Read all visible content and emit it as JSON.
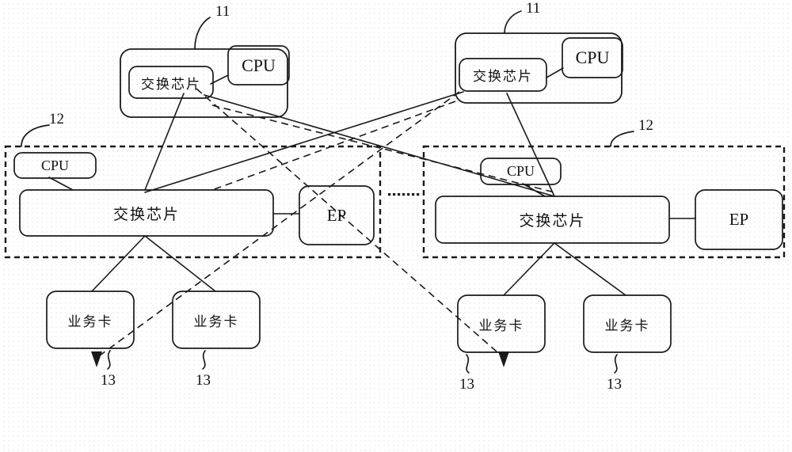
{
  "figure": {
    "kind": "patent-block-diagram",
    "stroke_color": "#1a1a1a",
    "background_color": "#ffffff",
    "dot_grid_color": "#c9c9c9"
  },
  "labels": {
    "switch_chip": "交换芯片",
    "cpu": "CPU",
    "ep": "EP",
    "service_card": "业务卡",
    "ref_11": "11",
    "ref_12": "12",
    "ref_13": "13",
    "ellipsis": "▫▫▫▫▫▫▫▫"
  },
  "modules": {
    "top": [
      {
        "id": "top-module-left",
        "ref": "11",
        "children": [
          {
            "id": "switch-chip",
            "label": "交换芯片"
          },
          {
            "id": "cpu",
            "label": "CPU"
          }
        ]
      },
      {
        "id": "top-module-right",
        "ref": "11",
        "children": [
          {
            "id": "switch-chip",
            "label": "交换芯片"
          },
          {
            "id": "cpu",
            "label": "CPU"
          }
        ]
      }
    ],
    "middle": [
      {
        "id": "line-card-left",
        "ref": "12",
        "children": [
          {
            "id": "cpu",
            "label": "CPU"
          },
          {
            "id": "switch-chip",
            "label": "交换芯片"
          },
          {
            "id": "ep",
            "label": "EP"
          }
        ]
      },
      {
        "id": "line-card-right",
        "ref": "12",
        "children": [
          {
            "id": "cpu",
            "label": "CPU"
          },
          {
            "id": "switch-chip",
            "label": "交换芯片"
          },
          {
            "id": "ep",
            "label": "EP"
          }
        ]
      }
    ],
    "bottom": [
      {
        "id": "service-card-1",
        "label": "业务卡",
        "ref": "13"
      },
      {
        "id": "service-card-2",
        "label": "业务卡",
        "ref": "13"
      },
      {
        "id": "service-card-3",
        "label": "业务卡",
        "ref": "13"
      },
      {
        "id": "service-card-4",
        "label": "业务卡",
        "ref": "13"
      }
    ]
  }
}
